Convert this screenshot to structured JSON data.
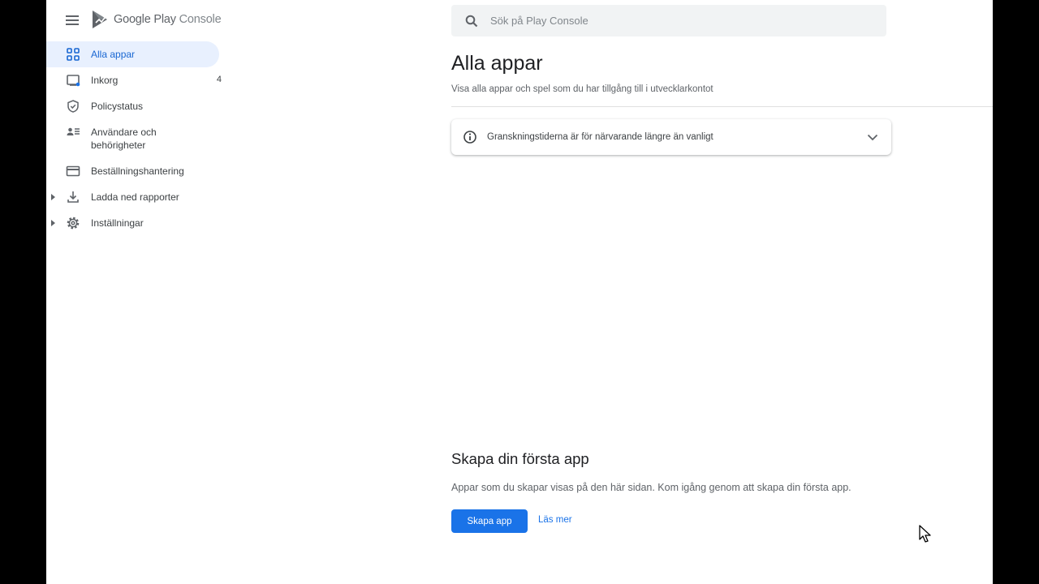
{
  "header": {
    "brand_primary": "Google Play",
    "brand_secondary": "Console"
  },
  "search": {
    "placeholder": "Sök på Play Console"
  },
  "sidebar": {
    "items": [
      {
        "label": "Alla appar",
        "icon": "apps-grid-icon",
        "active": true
      },
      {
        "label": "Inkorg",
        "icon": "inbox-icon",
        "count": "4"
      },
      {
        "label": "Policystatus",
        "icon": "shield-icon"
      },
      {
        "label": "Användare och behörigheter",
        "icon": "users-icon"
      },
      {
        "label": "Beställningshantering",
        "icon": "credit-card-icon"
      },
      {
        "label": "Ladda ned rapporter",
        "icon": "download-icon",
        "expandable": true
      },
      {
        "label": "Inställningar",
        "icon": "gear-icon",
        "expandable": true
      }
    ]
  },
  "main": {
    "title": "Alla appar",
    "subtitle": "Visa alla appar och spel som du har tillgång till i utvecklarkontot",
    "notice": {
      "text": "Granskningstiderna är för närvarande längre än vanligt",
      "icon": "info-icon"
    },
    "empty_state": {
      "title": "Skapa din första app",
      "text": "Appar som du skapar visas på den här sidan. Kom igång genom att skapa din första app.",
      "primary_button": "Skapa app",
      "link": "Läs mer"
    }
  },
  "colors": {
    "accent": "#1a73e8",
    "active_bg": "#e8f0fe",
    "active_text": "#1967d2"
  }
}
